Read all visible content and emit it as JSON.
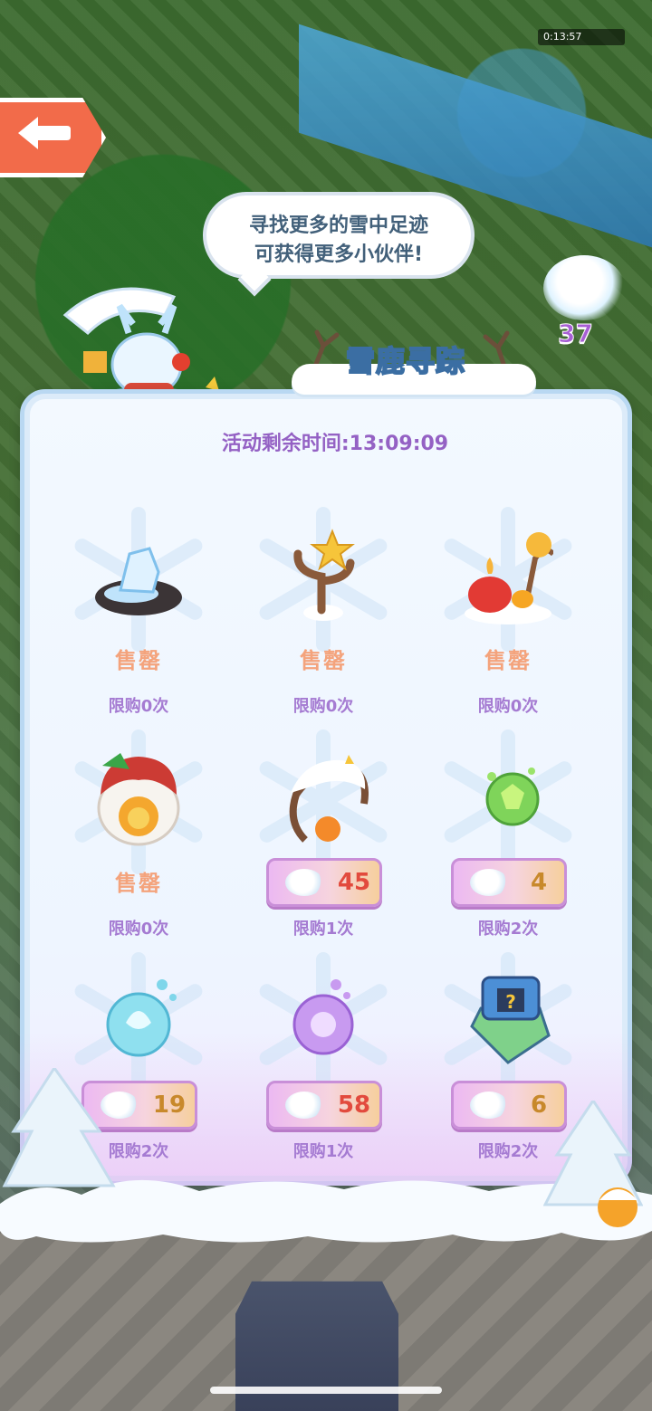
{
  "hud": {
    "timer": "0:13:57"
  },
  "speech": {
    "line1": "寻找更多的雪中足迹",
    "line2": "可获得更多小伙伴!"
  },
  "currency": {
    "count": "37"
  },
  "title": "雪鹿寻踪",
  "countdown": "活动剩余时间:13:09:09",
  "colors": {
    "amount_gold": "#c8892b",
    "amount_red": "#e24a3d",
    "sold_text": "#f4a37c",
    "limit_text": "#a57bd2"
  },
  "items": [
    {
      "name": "ice-rock-decor",
      "sold": "售罄",
      "limit": "限购0次"
    },
    {
      "name": "antler-star-decor",
      "sold": "售罄",
      "limit": "限购0次"
    },
    {
      "name": "candle-torch-decor",
      "sold": "售罄",
      "limit": "限购0次"
    },
    {
      "name": "snow-egg-chick",
      "sold": "售罄",
      "limit": "限购0次"
    },
    {
      "name": "snow-antler-chick",
      "price": "45",
      "limit": "限购1次"
    },
    {
      "name": "green-gem-orb",
      "price": "4",
      "limit": "限购2次"
    },
    {
      "name": "blue-crystal-orb",
      "price": "19",
      "limit": "限购2次"
    },
    {
      "name": "purple-crystal-orb",
      "price": "58",
      "limit": "限购1次"
    },
    {
      "name": "mystery-box",
      "price": "6",
      "limit": "限购2次"
    }
  ]
}
